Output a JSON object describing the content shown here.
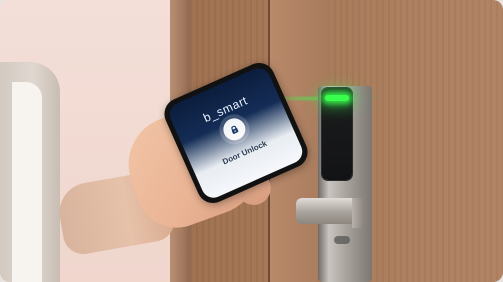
{
  "phone": {
    "brand": "b_smart",
    "action_label": "Door Unlock"
  },
  "scene": {
    "led_color": "#38ff4c",
    "door_color": "#a67958",
    "wall_color": "#efd9d2"
  },
  "icons": {
    "lock": "lock-icon"
  }
}
